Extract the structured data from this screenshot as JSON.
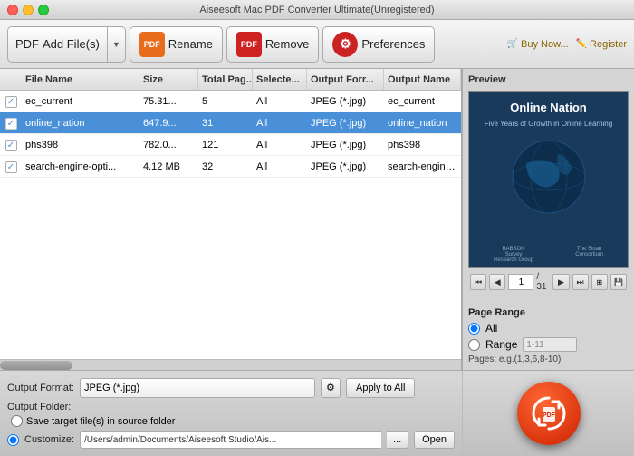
{
  "window": {
    "title": "Aiseesoft Mac PDF Converter Ultimate(Unregistered)"
  },
  "toolbar": {
    "add_files_label": "Add File(s)",
    "rename_label": "Rename",
    "remove_label": "Remove",
    "preferences_label": "Preferences",
    "buy_now": "Buy Now...",
    "register": "Register"
  },
  "table": {
    "headers": {
      "checkbox": "",
      "file_name": "File Name",
      "size": "Size",
      "total_pages": "Total Pag...",
      "selected": "Selecte...",
      "output_format": "Output Forr...",
      "output_name": "Output Name"
    },
    "rows": [
      {
        "checked": true,
        "file_name": "ec_current",
        "size": "75.31...",
        "total_pages": "5",
        "selected": "All",
        "output_format": "JPEG (*.jpg)",
        "output_name": "ec_current",
        "selected_row": false
      },
      {
        "checked": true,
        "file_name": "online_nation",
        "size": "647.9...",
        "total_pages": "31",
        "selected": "All",
        "output_format": "JPEG (*.jpg)",
        "output_name": "online_nation",
        "selected_row": true
      },
      {
        "checked": true,
        "file_name": "phs398",
        "size": "782.0...",
        "total_pages": "121",
        "selected": "All",
        "output_format": "JPEG (*.jpg)",
        "output_name": "phs398",
        "selected_row": false
      },
      {
        "checked": true,
        "file_name": "search-engine-opti...",
        "size": "4.12 MB",
        "total_pages": "32",
        "selected": "All",
        "output_format": "JPEG (*.jpg)",
        "output_name": "search-engine-optimizati...",
        "selected_row": false
      }
    ]
  },
  "preview": {
    "label": "Preview",
    "book_title": "Online Nation",
    "book_subtitle": "Five Years of Growth in Online Learning",
    "page_current": "1",
    "page_total": "31"
  },
  "nav_buttons": {
    "first": "⏮",
    "prev": "◀",
    "next": "▶",
    "last": "⏭"
  },
  "page_range": {
    "title": "Page Range",
    "all_label": "All",
    "range_label": "Range",
    "range_value": "1-11",
    "pages_hint": "Pages: e.g.(1,3,6,8-10)"
  },
  "bottom": {
    "output_format_label": "Output Format:",
    "output_folder_label": "Output Folder:",
    "format_value": "JPEG (*.jpg)",
    "apply_to_all": "Apply to All",
    "save_source_label": "Save target file(s) in source folder",
    "customize_label": "Customize:",
    "customize_path": "/Users/admin/Documents/Aiseesoft Studio/Ais...",
    "open_label": "Open",
    "dots_label": "..."
  }
}
